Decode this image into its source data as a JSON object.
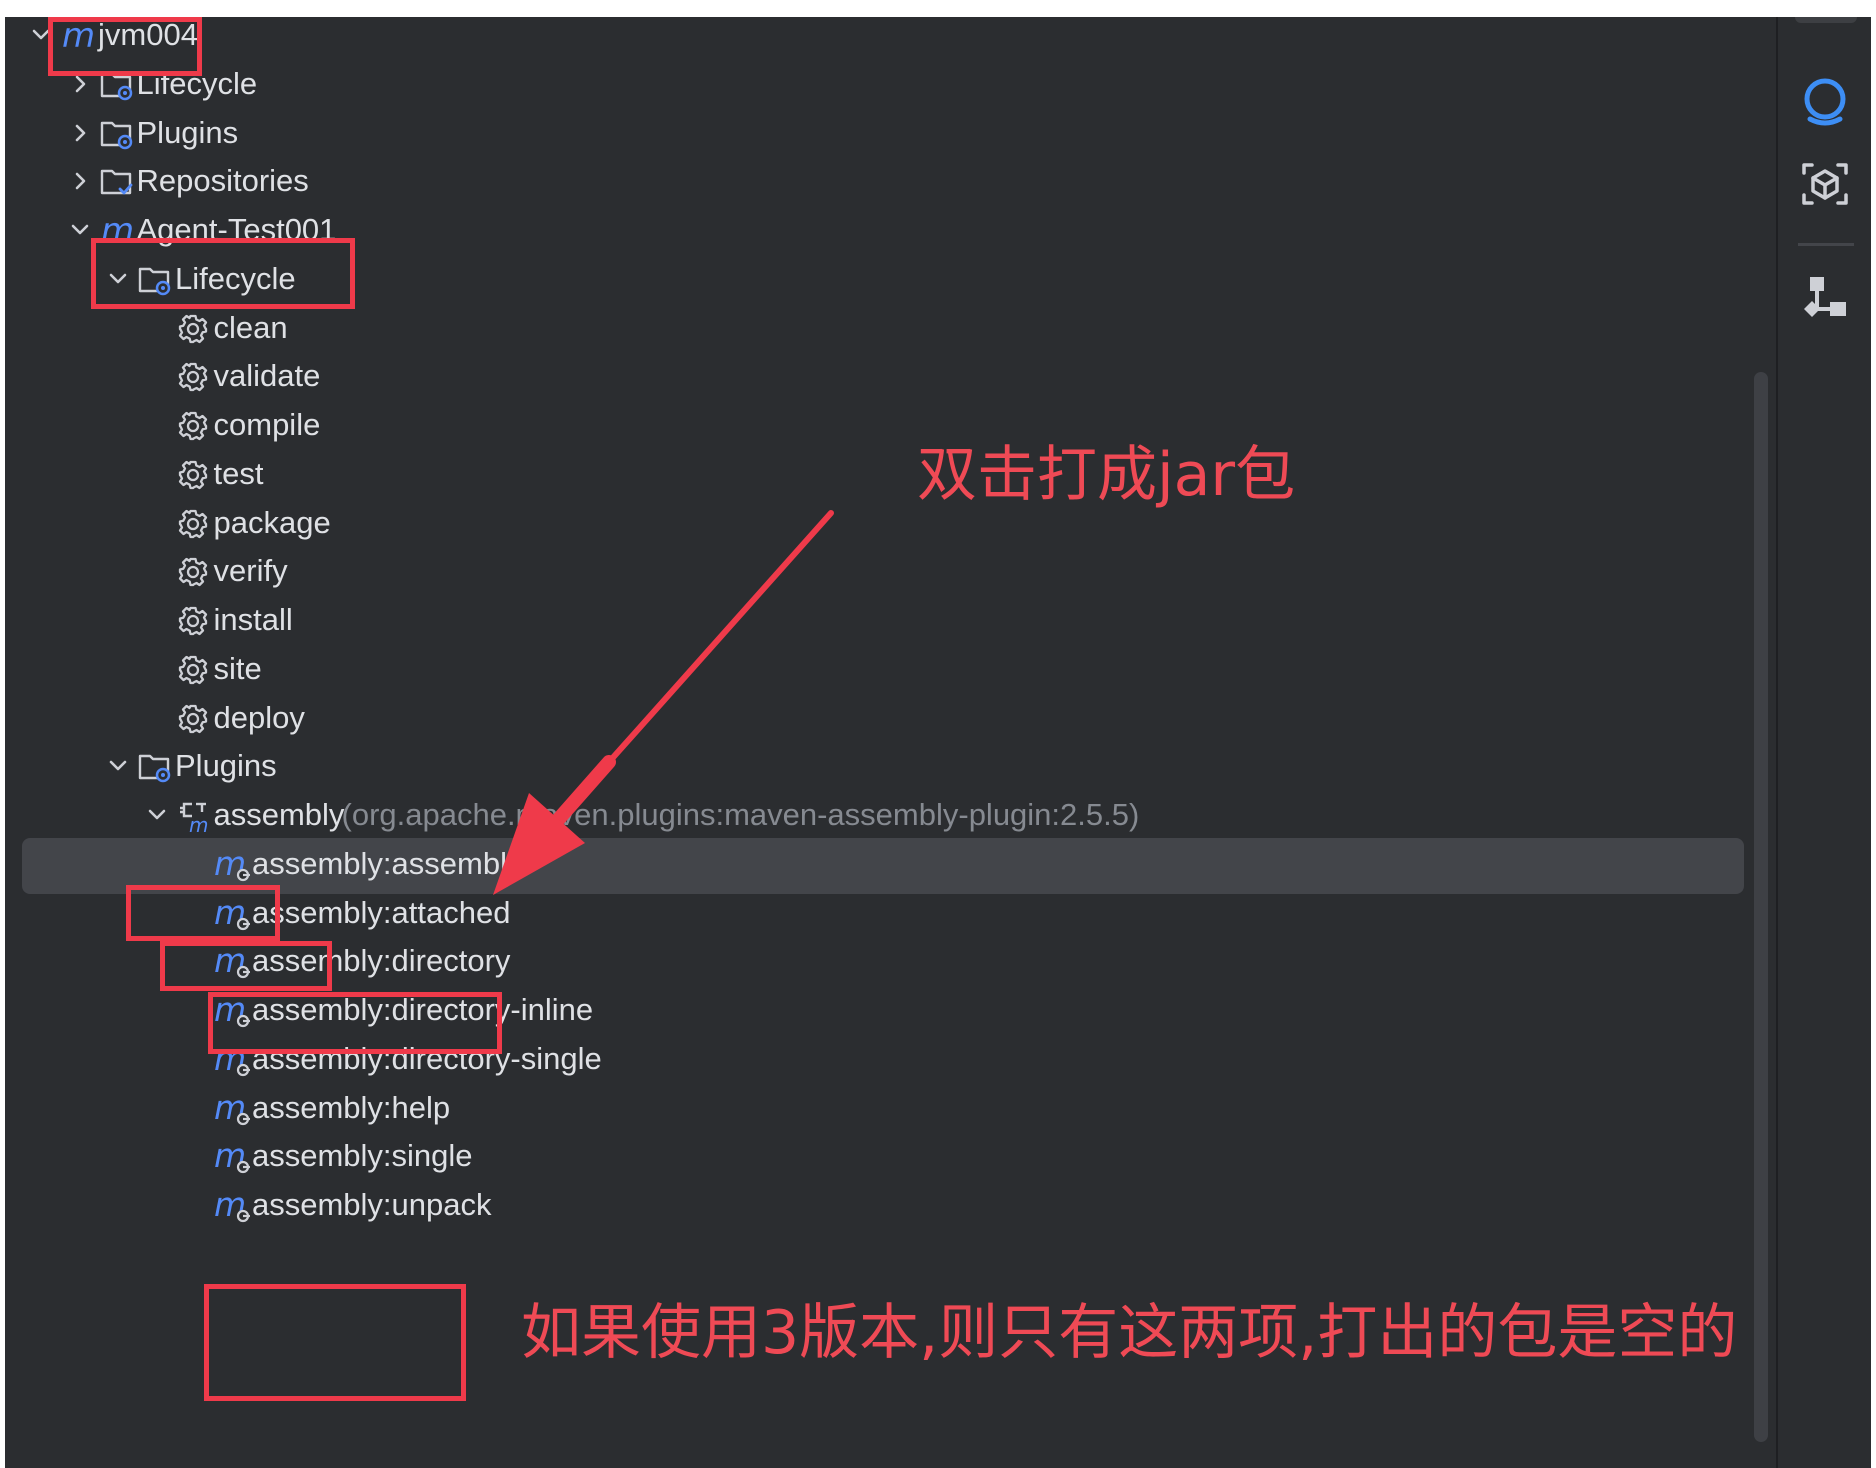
{
  "tree": {
    "rows": [
      {
        "label": "jvm004",
        "extra": "",
        "depth": 0,
        "chevron": "down",
        "icon": "maven-project-icon"
      },
      {
        "label": "Lifecycle",
        "extra": "",
        "depth": 1,
        "chevron": "right",
        "icon": "lifecycle-folder-icon"
      },
      {
        "label": "Plugins",
        "extra": "",
        "depth": 1,
        "chevron": "right",
        "icon": "plugins-folder-icon"
      },
      {
        "label": "Repositories",
        "extra": "",
        "depth": 1,
        "chevron": "right",
        "icon": "repositories-folder-icon"
      },
      {
        "label": "Agent-Test001",
        "extra": "",
        "depth": 1,
        "chevron": "down",
        "icon": "maven-project-icon"
      },
      {
        "label": "Lifecycle",
        "extra": "",
        "depth": 2,
        "chevron": "down",
        "icon": "lifecycle-folder-icon"
      },
      {
        "label": "clean",
        "extra": "",
        "depth": 3,
        "chevron": "none",
        "icon": "gear-icon"
      },
      {
        "label": "validate",
        "extra": "",
        "depth": 3,
        "chevron": "none",
        "icon": "gear-icon"
      },
      {
        "label": "compile",
        "extra": "",
        "depth": 3,
        "chevron": "none",
        "icon": "gear-icon"
      },
      {
        "label": "test",
        "extra": "",
        "depth": 3,
        "chevron": "none",
        "icon": "gear-icon"
      },
      {
        "label": "package",
        "extra": "",
        "depth": 3,
        "chevron": "none",
        "icon": "gear-icon"
      },
      {
        "label": "verify",
        "extra": "",
        "depth": 3,
        "chevron": "none",
        "icon": "gear-icon"
      },
      {
        "label": "install",
        "extra": "",
        "depth": 3,
        "chevron": "none",
        "icon": "gear-icon"
      },
      {
        "label": "site",
        "extra": "",
        "depth": 3,
        "chevron": "none",
        "icon": "gear-icon"
      },
      {
        "label": "deploy",
        "extra": "",
        "depth": 3,
        "chevron": "none",
        "icon": "gear-icon"
      },
      {
        "label": "Plugins",
        "extra": "",
        "depth": 2,
        "chevron": "down",
        "icon": "plugins-folder-icon"
      },
      {
        "label": "assembly",
        "extra": "(org.apache.maven.plugins:maven-assembly-plugin:2.5.5)",
        "depth": 3,
        "chevron": "down",
        "icon": "maven-plugin-icon"
      },
      {
        "label": "assembly:assembly",
        "extra": "",
        "depth": 4,
        "chevron": "none",
        "icon": "maven-goal-icon",
        "selected": true
      },
      {
        "label": "assembly:attached",
        "extra": "",
        "depth": 4,
        "chevron": "none",
        "icon": "maven-goal-icon"
      },
      {
        "label": "assembly:directory",
        "extra": "",
        "depth": 4,
        "chevron": "none",
        "icon": "maven-goal-icon"
      },
      {
        "label": "assembly:directory-inline",
        "extra": "",
        "depth": 4,
        "chevron": "none",
        "icon": "maven-goal-icon"
      },
      {
        "label": "assembly:directory-single",
        "extra": "",
        "depth": 4,
        "chevron": "none",
        "icon": "maven-goal-icon"
      },
      {
        "label": "assembly:help",
        "extra": "",
        "depth": 4,
        "chevron": "none",
        "icon": "maven-goal-icon"
      },
      {
        "label": "assembly:single",
        "extra": "",
        "depth": 4,
        "chevron": "none",
        "icon": "maven-goal-icon"
      },
      {
        "label": "assembly:unpack",
        "extra": "",
        "depth": 4,
        "chevron": "none",
        "icon": "maven-goal-icon"
      }
    ]
  },
  "annotations": {
    "double_click_note": "双击打成jar包",
    "version_note": "如果使用3版本,则只有这两项,打出的包是空的"
  },
  "sidebar": {
    "buttons": [
      "ai-assistant-icon",
      "cube-scan-icon",
      "structure-diagram-icon"
    ]
  },
  "colors": {
    "panel_bg": "#2b2d30",
    "selection_bg": "#43454a",
    "text": "#dfe1e5",
    "muted_text": "#868a91",
    "maven_blue": "#548af7",
    "annotation_red": "#ef3a4a"
  }
}
